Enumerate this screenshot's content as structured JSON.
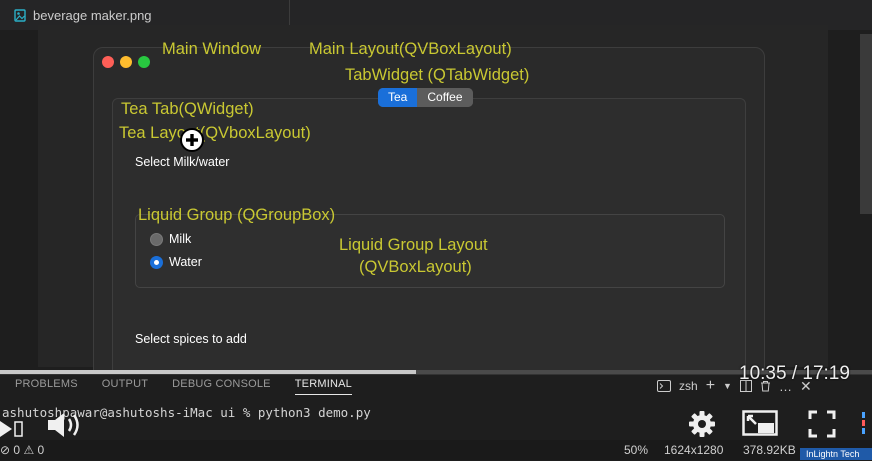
{
  "editor": {
    "file_tab": "beverage maker.png"
  },
  "window": {
    "tabs": [
      {
        "label": "Tea",
        "active": true
      },
      {
        "label": "Coffee",
        "active": false
      }
    ],
    "labels": {
      "select_milk_water": "Select Milk/water",
      "select_spices": "Select spices to add"
    },
    "radios": [
      {
        "label": "Milk",
        "checked": false
      },
      {
        "label": "Water",
        "checked": true
      }
    ]
  },
  "annotations": {
    "main_window": "Main Window",
    "main_layout": "Main Layout(QVBoxLayout)",
    "tab_widget": "TabWidget (QTabWidget)",
    "tea_tab": "Tea Tab(QWidget)",
    "tea_layout": "Tea Layout(QVboxLayout)",
    "liquid_group": "Liquid Group (QGroupBox)",
    "liquid_layout_1": "Liquid Group Layout",
    "liquid_layout_2": "(QVBoxLayout)"
  },
  "panel": {
    "tabs": [
      {
        "label": "PROBLEMS",
        "active": false
      },
      {
        "label": "OUTPUT",
        "active": false
      },
      {
        "label": "DEBUG CONSOLE",
        "active": false
      },
      {
        "label": "TERMINAL",
        "active": true
      }
    ],
    "shell": "zsh",
    "terminal_line": "ashutoshpawar@ashutoshs-iMac ui % python3 demo.py"
  },
  "video": {
    "timecode": "10:35 / 17:19",
    "progress": 0.477
  },
  "status": {
    "errors": "0",
    "warnings": "0",
    "zoom": "50%",
    "dimensions": "1624x1280",
    "file_size": "378.92KB",
    "watermark": "InLightn Tech"
  }
}
